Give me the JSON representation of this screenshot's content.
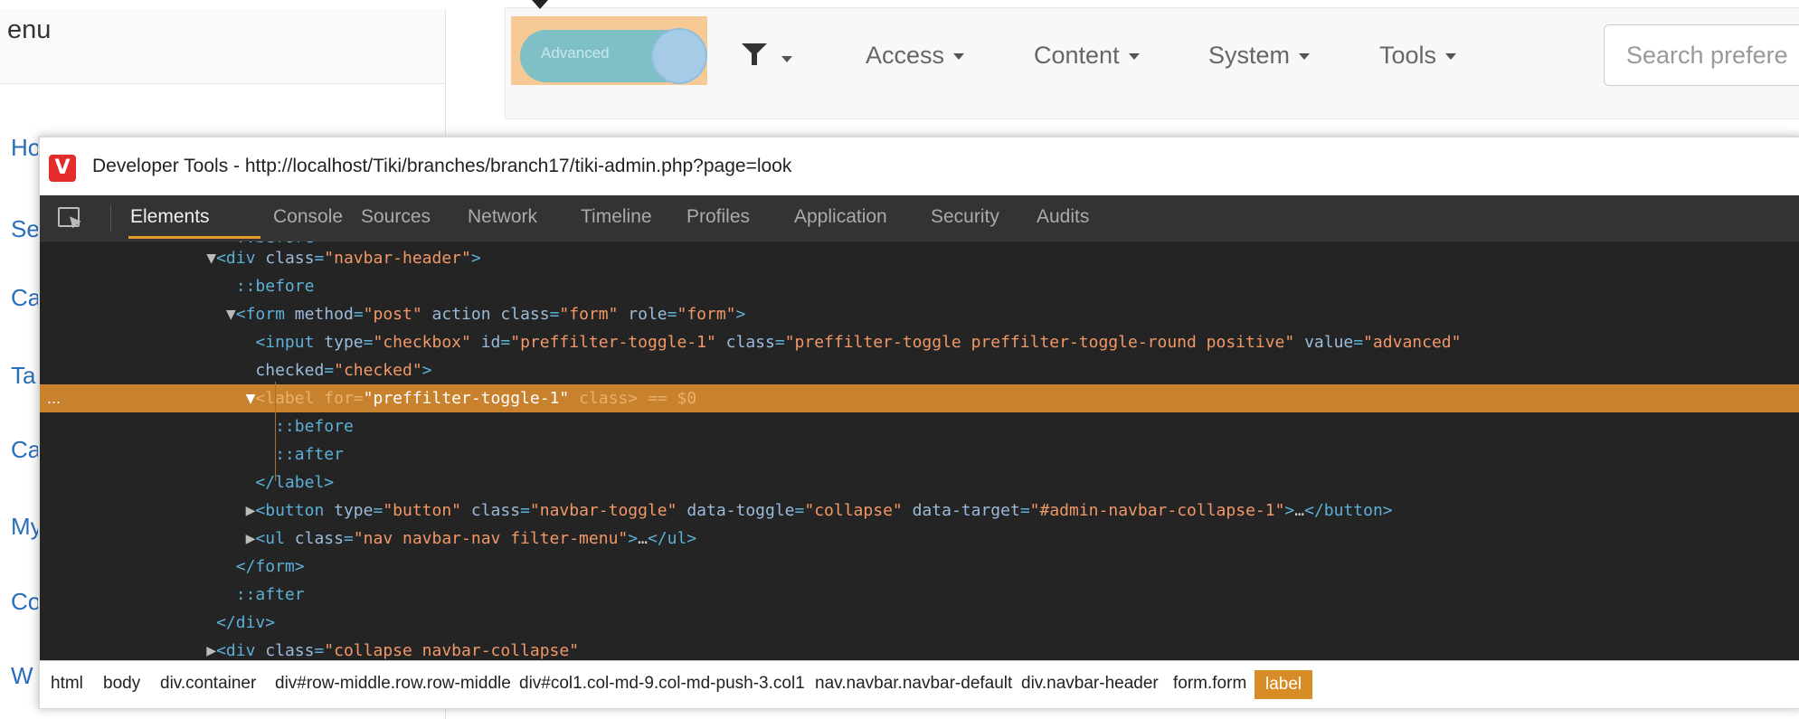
{
  "left_panel": {
    "menu_title": "enu",
    "items": [
      "Ho",
      "Se",
      "Ca",
      "Ta",
      "Ca",
      "My",
      "Co",
      "W"
    ]
  },
  "topnav": {
    "toggle_label": "Advanced",
    "menus": [
      "Access",
      "Content",
      "System",
      "Tools"
    ],
    "search_placeholder": "Search prefere"
  },
  "devtools": {
    "logo_letter": "V",
    "title": "Developer Tools - http://localhost/Tiki/branches/branch17/tiki-admin.php?page=look",
    "tabs": [
      "Elements",
      "Console",
      "Sources",
      "Network",
      "Timeline",
      "Profiles",
      "Application",
      "Security",
      "Audits"
    ],
    "active_tab": "Elements",
    "selected_marker": "== $0",
    "row_dots": "...",
    "breadcrumbs": [
      "html",
      "body",
      "div.container",
      "div#row-middle.row.row-middle",
      "div#col1.col-md-9.col-md-push-3.col1",
      "nav.navbar.navbar-default",
      "div.navbar-header",
      "form.form",
      "label"
    ],
    "active_breadcrumb": "label"
  },
  "colors": {
    "devtools_bg": "#242424",
    "selection_bg": "#c8812d",
    "tag": "#5db0d7",
    "attr_value": "#f29766",
    "toggle": "#7ec0c6",
    "breadcrumb_active": "#d88c26"
  },
  "icons": [
    "vivaldi-logo",
    "inspect-element-icon",
    "filter-icon",
    "caret-down-icon",
    "expand-triangle-icon"
  ]
}
